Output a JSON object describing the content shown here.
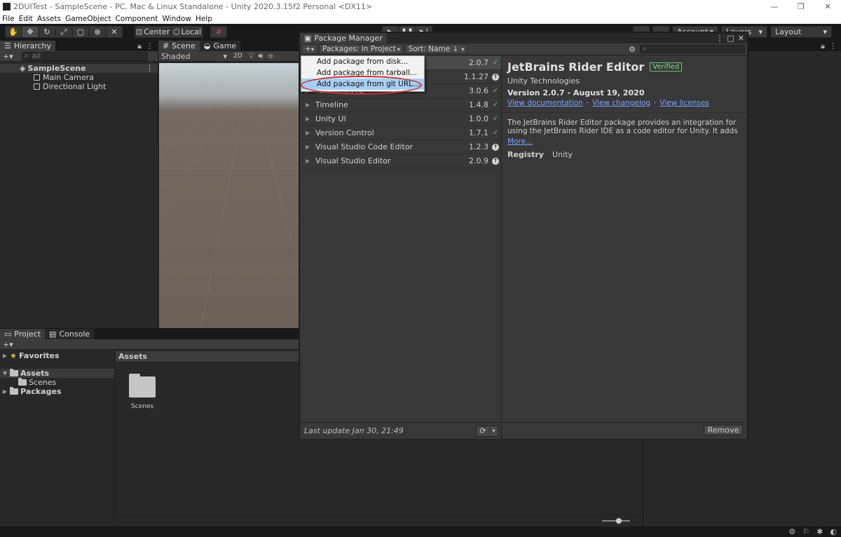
{
  "window": {
    "title": "2DUITest - SampleScene - PC, Mac & Linux Standalone - Unity 2020.3.15f2 Personal <DX11>"
  },
  "menubar": [
    "File",
    "Edit",
    "Assets",
    "GameObject",
    "Component",
    "Window",
    "Help"
  ],
  "toolbar": {
    "pivot_label": "Center",
    "space_label": "Local",
    "account_label": "Account",
    "layers_label": "Layers",
    "layout_label": "Layout"
  },
  "hierarchy": {
    "tab": "Hierarchy",
    "search_placeholder": "All",
    "scene": "SampleScene",
    "items": [
      "Main Camera",
      "Directional Light"
    ]
  },
  "scene_view": {
    "tabs": [
      "Scene",
      "Game"
    ],
    "shading": "Shaded",
    "mode_2d": "2D"
  },
  "project": {
    "tabs": [
      "Project",
      "Console"
    ],
    "favorites": "Favorites",
    "assets": "Assets",
    "scenes": "Scenes",
    "packages": "Packages",
    "breadcrumb": "Assets",
    "folder_label": "Scenes"
  },
  "package_manager": {
    "title": "Package Manager",
    "packages_filter": "Packages: In Project",
    "sort": "Sort: Name ↓",
    "packages": [
      {
        "name": "",
        "version": "2.0.7",
        "status": "verified"
      },
      {
        "name": "",
        "version": "1.1.27",
        "status": "update"
      },
      {
        "name": "TextMeshPro",
        "version": "3.0.6",
        "status": "verified"
      },
      {
        "name": "Timeline",
        "version": "1.4.8",
        "status": "verified"
      },
      {
        "name": "Unity UI",
        "version": "1.0.0",
        "status": "verified"
      },
      {
        "name": "Version Control",
        "version": "1.7.1",
        "status": "verified"
      },
      {
        "name": "Visual Studio Code Editor",
        "version": "1.2.3",
        "status": "update"
      },
      {
        "name": "Visual Studio Editor",
        "version": "2.0.9",
        "status": "update"
      }
    ],
    "last_update": "Last update Jan 30, 21:49",
    "detail": {
      "name": "JetBrains Rider Editor",
      "badge": "Verified",
      "author": "Unity Technologies",
      "version_line": "Version 2.0.7 - August 19, 2020",
      "links": [
        "View documentation",
        "View changelog",
        "View licenses"
      ],
      "description": "The JetBrains Rider Editor package provides an integration for using the JetBrains Rider IDE as a code editor for Unity. It adds support for generating .csproj files for code completion and auto-discovery of",
      "more": "More...",
      "registry_label": "Registry",
      "registry_value": "Unity"
    },
    "remove_label": "Remove",
    "add_menu": [
      "Add package from disk...",
      "Add package from tarball...",
      "Add package from git URL..."
    ]
  },
  "colors": {
    "accent_ring": "#c8303a",
    "menu_selection": "#a9cef5",
    "verified": "#6bbf6b",
    "link": "#7aa5ff"
  }
}
